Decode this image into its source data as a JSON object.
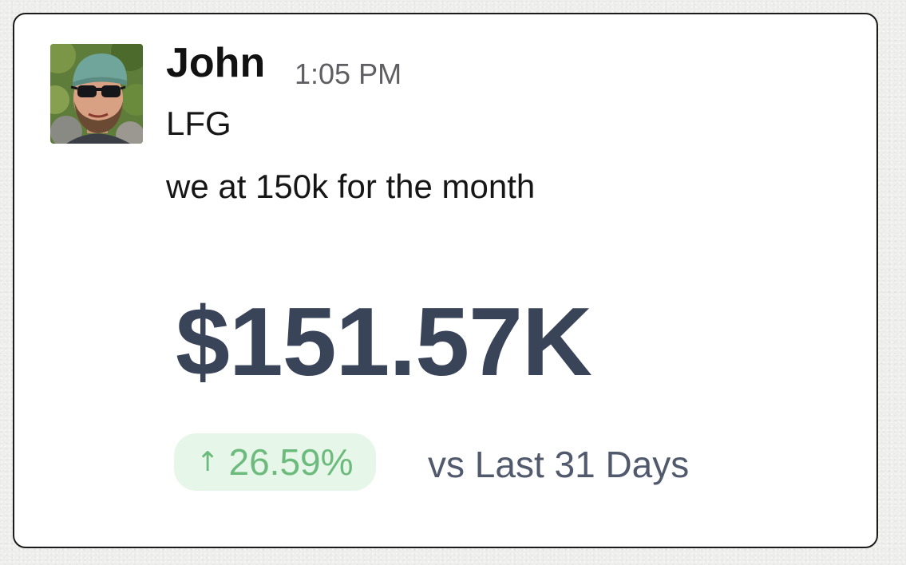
{
  "message": {
    "author": "John",
    "timestamp": "1:05 PM",
    "lines": [
      "LFG",
      "we at 150k for the month"
    ]
  },
  "metric": {
    "value": "$151.57K",
    "change": {
      "icon": "arrow-up-icon",
      "arrow_glyph": "↑",
      "percent": "26.59%",
      "color": "#6dbb7c",
      "background": "#e6f6e9"
    },
    "comparison": "vs Last 31 Days"
  },
  "colors": {
    "metric_text": "#3a4459",
    "timestamp_text": "#5f5f63"
  }
}
